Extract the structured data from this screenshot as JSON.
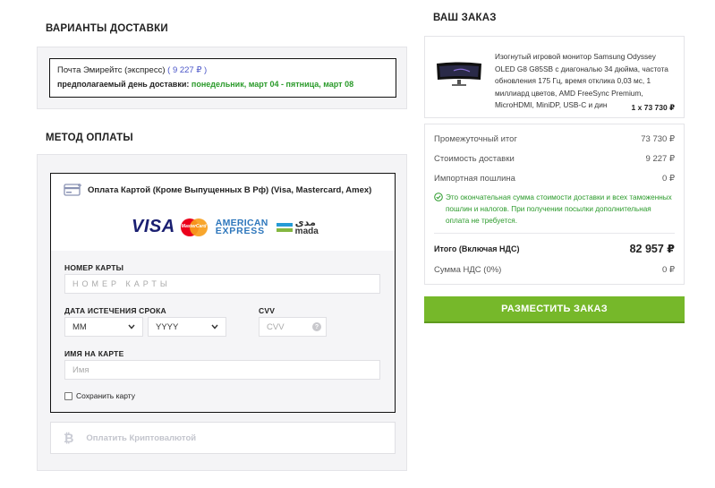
{
  "delivery": {
    "heading": "ВАРИАНТЫ ДОСТАВКИ",
    "option_name": "Почта Эмирейтс (экспресс)",
    "option_price": "( 9 227 ₽ )",
    "date_label": "предполагаемый день доставки:",
    "date_value": "понедельник, март 04 - пятница, март 08"
  },
  "payment": {
    "heading": "МЕТОД ОПЛАТЫ",
    "card_option_label": "Оплата Картой (Кроме Выпущенных В Рф) (Visa, Mastercard, Amex)",
    "logos": [
      "VISA",
      "MasterCard",
      "AMERICAN",
      "EXPRESS",
      "مدى",
      "mada"
    ],
    "card_number_label": "НОМЕР КАРТЫ",
    "card_number_placeholder": "НОМЕР КАРТЫ",
    "expiry_label": "ДАТА ИСТЕЧЕНИЯ СРОКА",
    "month_value": "MM",
    "year_value": "YYYY",
    "cvv_label": "CVV",
    "cvv_placeholder": "CVV",
    "name_label": "ИМЯ НА КАРТЕ",
    "name_placeholder": "Имя",
    "save_card_label": "Сохранить карту",
    "crypto_label": "Оплатить Криптовалютой"
  },
  "order": {
    "heading": "ВАШ ЗАКАЗ",
    "product_title": "Изогнутый игровой монитор Samsung Odyssey OLED G8 G85SB с диагональю 34 дюйма, частота обновления 175 Гц, время отклика 0,03 мс, 1 миллиард цветов, AMD FreeSync Premium, MicroHDMI, MiniDP, USB-C и дин",
    "product_qty_price": "1 x 73 730 ₽",
    "subtotal_label": "Промежуточный итог",
    "subtotal_value": "73 730 ₽",
    "shipping_label": "Стоимость доставки",
    "shipping_value": "9 227 ₽",
    "duty_label": "Импортная пошлина",
    "duty_value": "0 ₽",
    "notice": "Это окончательная сумма стоимости доставки и всех таможенных пошлин и налогов. При получении посылки дополнительная оплата не требуется.",
    "total_label": "Итого (Включая НДС)",
    "total_value": "82 957 ₽",
    "vat_label": "Сумма НДС (0%)",
    "vat_value": "0 ₽",
    "place_order_label": "РАЗМЕСТИТЬ ЗАКАЗ"
  },
  "colors": {
    "accent_green": "#76b82a",
    "price_blue": "#4a55c8",
    "date_green": "#2a9a2a"
  },
  "icons": [
    "credit-card-icon",
    "checkmark-circle-icon",
    "bitcoin-icon",
    "chevron-down-icon",
    "help-icon"
  ]
}
